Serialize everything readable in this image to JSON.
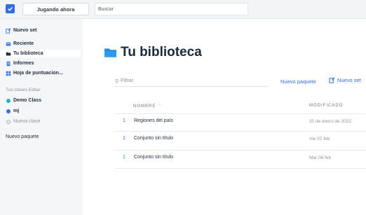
{
  "topbar": {
    "logo_icon": "check-logo-icon",
    "playing_label": "Jugando ahora",
    "search_placeholder": "Buscar"
  },
  "sidebar": {
    "new_set": "Nuevo set",
    "items": [
      {
        "label": "Reciente",
        "icon": "inbox-icon"
      },
      {
        "label": "Tu biblioteca",
        "icon": "folder-icon"
      },
      {
        "label": "Informes",
        "icon": "report-icon"
      },
      {
        "label": "Hoja de puntuacion...",
        "icon": "scoresheet-icon"
      }
    ],
    "classes_label": "Tus clases",
    "classes_edit": "Editar",
    "classes": [
      {
        "label": "Demo Class",
        "color": "#1bb5c9"
      },
      {
        "label": "mj",
        "color": "#2f6fe0"
      }
    ],
    "new_class": "Nueva clase",
    "new_package": "Nuevo paquete"
  },
  "main": {
    "title": "Tu biblioteca",
    "filter_placeholder": "Filtrar",
    "new_package": "Nuevo paquete",
    "new_set": "Nuevo set",
    "columns": {
      "name": "NOMBRE",
      "modified": "MODIFICADO"
    },
    "rows": [
      {
        "count": "1",
        "name": "Regiones del país",
        "modified": "31 de enero de 2022"
      },
      {
        "count": "1",
        "name": "Conjunto sin título",
        "modified": "Vie 02 feb"
      },
      {
        "count": "1",
        "name": "Conjunto sin título",
        "modified": "Mar 06 feb"
      }
    ]
  },
  "colors": {
    "accent": "#2f6fe0",
    "sidebar_bg": "#f5f6f8",
    "text": "#1c2b3a",
    "muted": "#8a949e"
  }
}
